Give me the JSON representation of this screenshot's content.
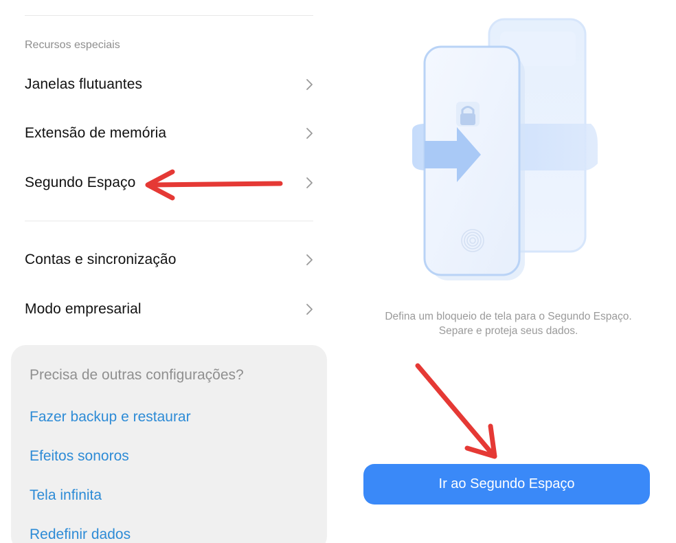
{
  "settings": {
    "section_label": "Recursos especiais",
    "items": [
      {
        "label": "Janelas flutuantes"
      },
      {
        "label": "Extensão de memória"
      },
      {
        "label": "Segundo Espaço"
      },
      {
        "label": "Contas e sincronização"
      },
      {
        "label": "Modo empresarial"
      }
    ]
  },
  "help": {
    "title": "Precisa de outras configurações?",
    "links": [
      {
        "label": "Fazer backup e restaurar"
      },
      {
        "label": "Efeitos sonoros"
      },
      {
        "label": "Tela infinita"
      },
      {
        "label": "Redefinir dados"
      }
    ]
  },
  "second_space": {
    "description_line1": "Defina um bloqueio de tela para o Segundo Espaço.",
    "description_line2": "Separe e proteja seus dados.",
    "button_label": "Ir ao Segundo Espaço"
  },
  "colors": {
    "link": "#2d8bd6",
    "button": "#3a89f8",
    "annotation_arrow": "#e53935"
  },
  "icons": [
    "chevron-right-icon",
    "lock-icon",
    "fingerprint-icon",
    "transfer-arrow-icon"
  ]
}
